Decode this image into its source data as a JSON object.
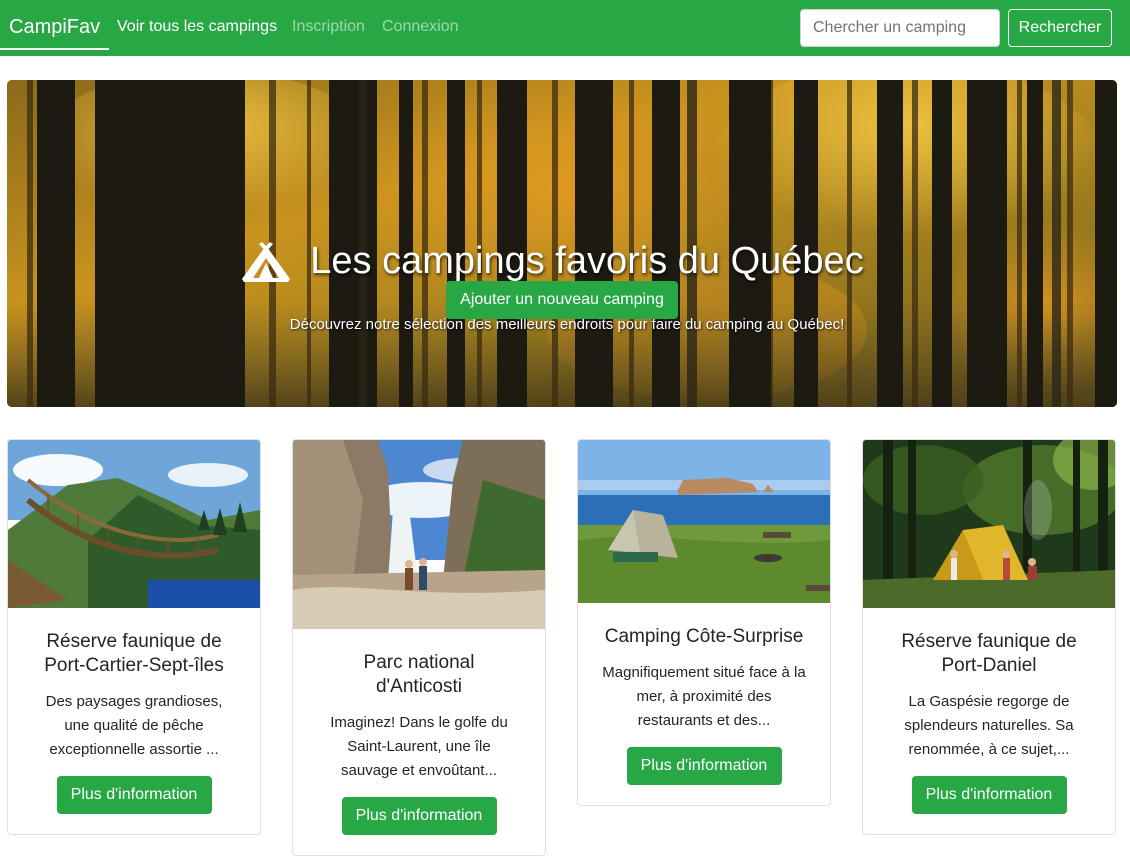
{
  "navbar": {
    "brand": "CampiFav",
    "links": [
      {
        "label": "Voir tous les campings",
        "active": true
      },
      {
        "label": "Inscription",
        "active": false
      },
      {
        "label": "Connexion",
        "active": false
      }
    ],
    "search_placeholder": "Chercher un camping",
    "search_button": "Rechercher",
    "bg_color": "#28a745"
  },
  "hero": {
    "icon": "campground-icon",
    "title": "Les campings favoris du Québec",
    "subtitle": "Découvrez notre sélection des meilleurs endroits pour faire du camping au Québec!",
    "button": "Ajouter un nouveau camping"
  },
  "cards": [
    {
      "title": "Réserve faunique de Port-Cartier-Sept-îles",
      "text": "Des paysages grandioses, une qualité de pêche exceptionnelle assortie ...",
      "button": "Plus d'information"
    },
    {
      "title": "Parc national d'Anticosti",
      "text": "Imaginez! Dans le golfe du Saint-Laurent, une île sauvage et envoûtant...",
      "button": "Plus d'information"
    },
    {
      "title": "Camping Côte-Surprise",
      "text": "Magnifiquement situé face à la mer, à proximité des restaurants et des...",
      "button": "Plus d'information"
    },
    {
      "title": "Réserve faunique de Port-Daniel",
      "text": "La Gaspésie regorge de splendeurs naturelles. Sa renommée, à ce sujet,...",
      "button": "Plus d'information"
    }
  ],
  "accent_color": "#28a745"
}
